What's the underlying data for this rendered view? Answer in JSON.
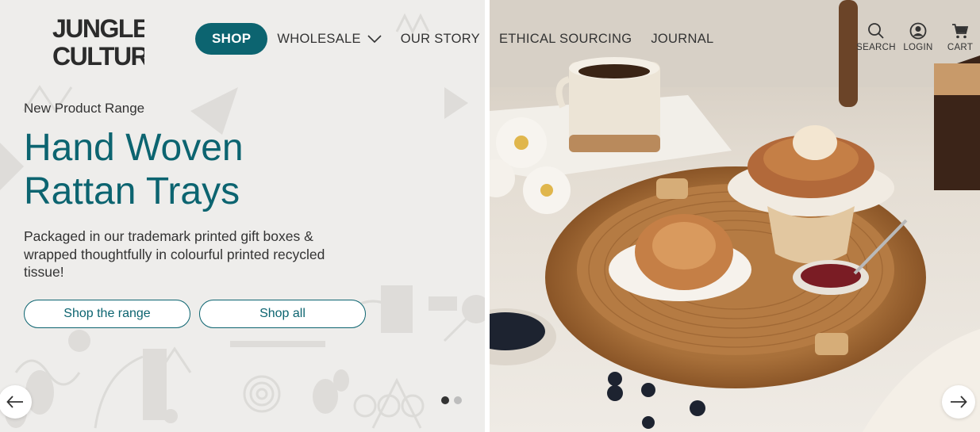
{
  "brand": {
    "logo_line1": "JUNGLE",
    "logo_line2": "CULTURE"
  },
  "nav": {
    "items": [
      {
        "label": "SHOP"
      },
      {
        "label": "WHOLESALE"
      },
      {
        "label": "OUR STORY"
      },
      {
        "label": "ETHICAL SOURCING"
      },
      {
        "label": "JOURNAL"
      }
    ]
  },
  "header_actions": {
    "search": "SEARCH",
    "login": "LOGIN",
    "cart": "CART"
  },
  "hero": {
    "eyebrow": "New Product Range",
    "headline_line1": "Hand Woven",
    "headline_line2": "Rattan Trays",
    "body": "Packaged in our trademark printed gift boxes & wrapped thoughtfully in colourful printed recycled tissue!",
    "primary_button": "Shop the range",
    "secondary_button": "Shop all",
    "image_description": "rattan-tray-with-pastries-photo"
  },
  "slider": {
    "slide_count": 2,
    "active_slide": 1
  },
  "colors": {
    "accent": "#0c6470",
    "panel_bg": "#eeedeb",
    "text": "#333333"
  }
}
